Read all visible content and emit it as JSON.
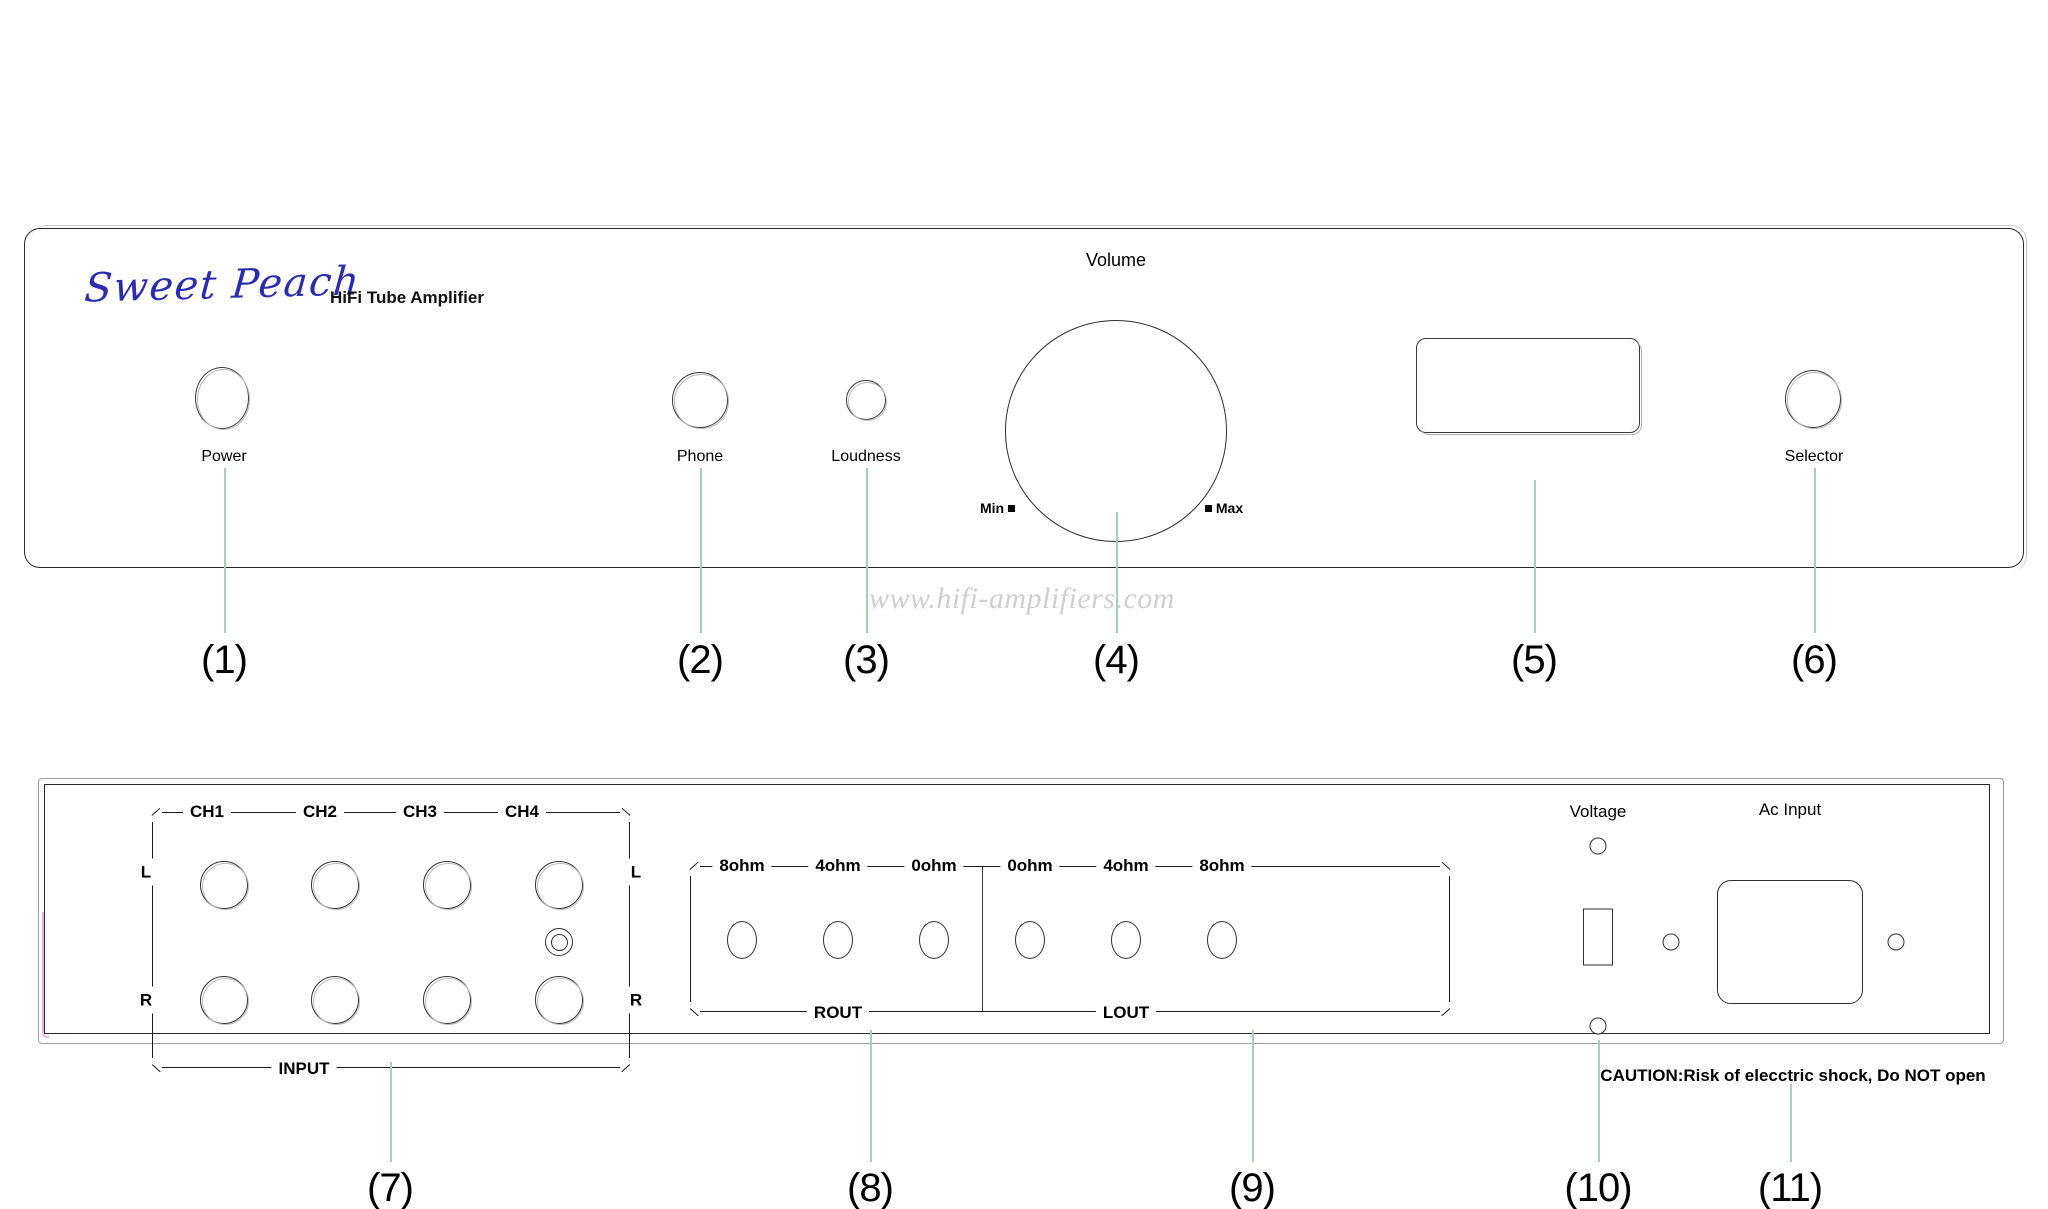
{
  "document": {
    "title": "Sweet Peach HiFi Tube Amplifier - Front and Rear Panel Diagram",
    "watermark": "www.hifi-amplifiers.com"
  },
  "front_panel": {
    "brand": "Sweet Peach",
    "brand_subtitle": "HiFi Tube Amplifier",
    "brand_color": "#2b2bb0",
    "controls": {
      "power_label": "Power",
      "phone_label": "Phone",
      "loudness_label": "Loudness",
      "volume_label": "Volume",
      "volume_min_label": "Min",
      "volume_max_label": "Max",
      "selector_label": "Selector"
    }
  },
  "rear_panel": {
    "input_group": {
      "group_label": "INPUT",
      "channels": [
        "CH1",
        "CH2",
        "CH3",
        "CH4"
      ],
      "row_left_label": "L",
      "row_right_label": "R"
    },
    "output_group": {
      "right_label": "ROUT",
      "left_label": "LOUT",
      "right_taps": [
        "8ohm",
        "4ohm",
        "0ohm"
      ],
      "left_taps": [
        "0ohm",
        "4ohm",
        "8ohm"
      ]
    },
    "power_section": {
      "voltage_label": "Voltage",
      "ac_input_label": "Ac Input",
      "caution_text": "CAUTION:Risk of elecctric shock, Do NOT open"
    }
  },
  "callouts": [
    {
      "number": "(1)",
      "target": "Power"
    },
    {
      "number": "(2)",
      "target": "Phone"
    },
    {
      "number": "(3)",
      "target": "Loudness"
    },
    {
      "number": "(4)",
      "target": "Volume"
    },
    {
      "number": "(5)",
      "target": "Display"
    },
    {
      "number": "(6)",
      "target": "Selector"
    },
    {
      "number": "(7)",
      "target": "Input"
    },
    {
      "number": "(8)",
      "target": "ROUT"
    },
    {
      "number": "(9)",
      "target": "LOUT"
    },
    {
      "number": "(10)",
      "target": "Voltage"
    },
    {
      "number": "(11)",
      "target": "Ac Input"
    }
  ],
  "colors": {
    "leader_line": "#a9cfb4",
    "panel_outline": "#2b2b2b",
    "watermark": "#cfcfcf",
    "pink_edge": "#eab6e0"
  }
}
